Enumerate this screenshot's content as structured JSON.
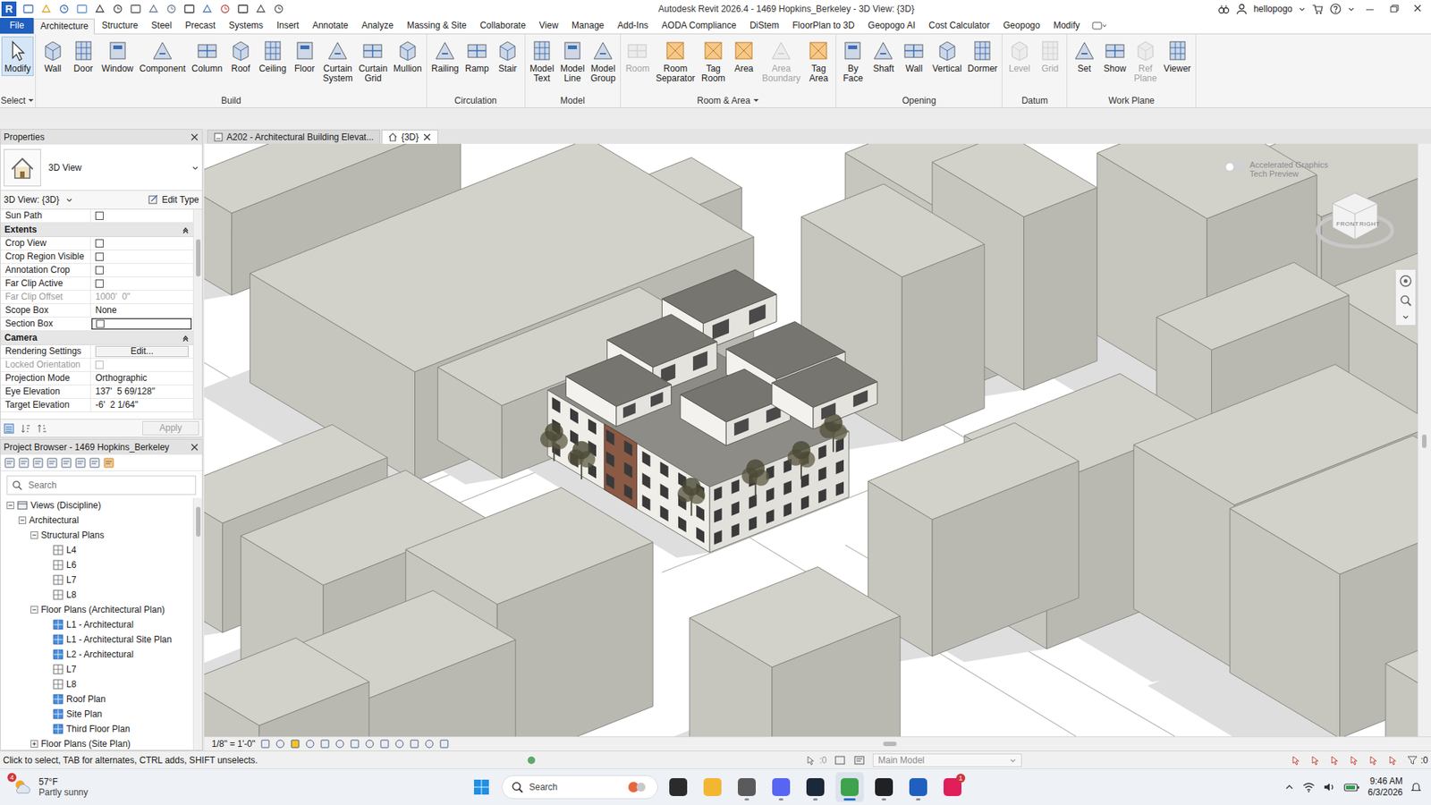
{
  "window": {
    "title": "Autodesk Revit 2026.4 - 1469 Hopkins_Berkeley - 3D View: {3D}",
    "app_letter": "R",
    "user": "hellopogo"
  },
  "ribbon_tabs": [
    {
      "label": "File",
      "selected": false,
      "kind": "file"
    },
    {
      "label": "Architecture",
      "selected": true,
      "kind": "tab"
    },
    {
      "label": "Structure",
      "selected": false,
      "kind": "tab"
    },
    {
      "label": "Steel",
      "selected": false,
      "kind": "tab"
    },
    {
      "label": "Precast",
      "selected": false,
      "kind": "tab"
    },
    {
      "label": "Systems",
      "selected": false,
      "kind": "tab"
    },
    {
      "label": "Insert",
      "selected": false,
      "kind": "tab"
    },
    {
      "label": "Annotate",
      "selected": false,
      "kind": "tab"
    },
    {
      "label": "Analyze",
      "selected": false,
      "kind": "tab"
    },
    {
      "label": "Massing & Site",
      "selected": false,
      "kind": "tab"
    },
    {
      "label": "Collaborate",
      "selected": false,
      "kind": "tab"
    },
    {
      "label": "View",
      "selected": false,
      "kind": "tab"
    },
    {
      "label": "Manage",
      "selected": false,
      "kind": "tab"
    },
    {
      "label": "Add-Ins",
      "selected": false,
      "kind": "tab"
    },
    {
      "label": "AODA Compliance",
      "selected": false,
      "kind": "tab"
    },
    {
      "label": "DiStem",
      "selected": false,
      "kind": "tab"
    },
    {
      "label": "FloorPlan to 3D",
      "selected": false,
      "kind": "tab"
    },
    {
      "label": "Geopogo AI",
      "selected": false,
      "kind": "tab"
    },
    {
      "label": "Cost Calculator",
      "selected": false,
      "kind": "tab"
    },
    {
      "label": "Geopogo",
      "selected": false,
      "kind": "tab"
    },
    {
      "label": "Modify",
      "selected": false,
      "kind": "tab"
    }
  ],
  "ribbon_groups": [
    {
      "label": "Select",
      "menu": true,
      "buttons": [
        {
          "label": "Modify",
          "selected": true,
          "disabled": false
        }
      ]
    },
    {
      "label": "Build",
      "menu": false,
      "buttons": [
        {
          "label": "Wall",
          "selected": false,
          "disabled": false
        },
        {
          "label": "Door",
          "selected": false,
          "disabled": false
        },
        {
          "label": "Window",
          "selected": false,
          "disabled": false
        },
        {
          "label": "Component",
          "selected": false,
          "disabled": false
        },
        {
          "label": "Column",
          "selected": false,
          "disabled": false
        },
        {
          "label": "Roof",
          "selected": false,
          "disabled": false
        },
        {
          "label": "Ceiling",
          "selected": false,
          "disabled": false
        },
        {
          "label": "Floor",
          "selected": false,
          "disabled": false
        },
        {
          "label": "Curtain\nSystem",
          "selected": false,
          "disabled": false
        },
        {
          "label": "Curtain\nGrid",
          "selected": false,
          "disabled": false
        },
        {
          "label": "Mullion",
          "selected": false,
          "disabled": false
        }
      ]
    },
    {
      "label": "Circulation",
      "menu": false,
      "buttons": [
        {
          "label": "Railing",
          "selected": false,
          "disabled": false
        },
        {
          "label": "Ramp",
          "selected": false,
          "disabled": false
        },
        {
          "label": "Stair",
          "selected": false,
          "disabled": false
        }
      ]
    },
    {
      "label": "Model",
      "menu": false,
      "buttons": [
        {
          "label": "Model\nText",
          "selected": false,
          "disabled": false
        },
        {
          "label": "Model\nLine",
          "selected": false,
          "disabled": false
        },
        {
          "label": "Model\nGroup",
          "selected": false,
          "disabled": false
        }
      ]
    },
    {
      "label": "Room & Area",
      "menu": true,
      "buttons": [
        {
          "label": "Room",
          "selected": false,
          "disabled": true
        },
        {
          "label": "Room\nSeparator",
          "selected": false,
          "disabled": false
        },
        {
          "label": "Tag\nRoom",
          "selected": false,
          "disabled": false
        },
        {
          "label": "Area",
          "selected": false,
          "disabled": false
        },
        {
          "label": "Area\nBoundary",
          "selected": false,
          "disabled": true
        },
        {
          "label": "Tag\nArea",
          "selected": false,
          "disabled": false
        }
      ]
    },
    {
      "label": "Opening",
      "menu": false,
      "buttons": [
        {
          "label": "By\nFace",
          "selected": false,
          "disabled": false
        },
        {
          "label": "Shaft",
          "selected": false,
          "disabled": false
        },
        {
          "label": "Wall",
          "selected": false,
          "disabled": false
        },
        {
          "label": "Vertical",
          "selected": false,
          "disabled": false
        },
        {
          "label": "Dormer",
          "selected": false,
          "disabled": false
        }
      ]
    },
    {
      "label": "Datum",
      "menu": false,
      "buttons": [
        {
          "label": "Level",
          "selected": false,
          "disabled": true
        },
        {
          "label": "Grid",
          "selected": false,
          "disabled": true
        }
      ]
    },
    {
      "label": "Work Plane",
      "menu": false,
      "buttons": [
        {
          "label": "Set",
          "selected": false,
          "disabled": false
        },
        {
          "label": "Show",
          "selected": false,
          "disabled": false
        },
        {
          "label": "Ref\nPlane",
          "selected": false,
          "disabled": true
        },
        {
          "label": "Viewer",
          "selected": false,
          "disabled": false
        }
      ]
    }
  ],
  "properties": {
    "title": "Properties",
    "type_name": "3D View",
    "instance": "3D View: {3D}",
    "edit_type": "Edit Type",
    "rows": [
      {
        "kind": "check",
        "label": "Sun Path",
        "checked": false,
        "disabled": false,
        "selected": false
      },
      {
        "kind": "section",
        "label": "Extents",
        "expanded": true,
        "selected": false
      },
      {
        "kind": "check",
        "label": "Crop View",
        "checked": false,
        "disabled": false,
        "selected": false
      },
      {
        "kind": "check",
        "label": "Crop Region Visible",
        "checked": false,
        "disabled": false,
        "selected": false
      },
      {
        "kind": "check",
        "label": "Annotation Crop",
        "checked": false,
        "disabled": false,
        "selected": false
      },
      {
        "kind": "check",
        "label": "Far Clip Active",
        "checked": false,
        "disabled": false,
        "selected": false
      },
      {
        "kind": "text",
        "label": "Far Clip Offset",
        "value": "1000'  0\"",
        "disabled": true,
        "selected": false
      },
      {
        "kind": "text",
        "label": "Scope Box",
        "value": "None",
        "disabled": false,
        "selected": false
      },
      {
        "kind": "check",
        "label": "Section Box",
        "checked": false,
        "disabled": false,
        "selected": true
      },
      {
        "kind": "section",
        "label": "Camera",
        "expanded": true,
        "selected": false
      },
      {
        "kind": "button",
        "label": "Rendering Settings",
        "value": "Edit...",
        "disabled": false,
        "selected": false
      },
      {
        "kind": "check",
        "label": "Locked Orientation",
        "checked": false,
        "disabled": true,
        "selected": false
      },
      {
        "kind": "text",
        "label": "Projection Mode",
        "value": "Orthographic",
        "disabled": false,
        "selected": false
      },
      {
        "kind": "text",
        "label": "Eye Elevation",
        "value": "137'  5 69/128\"",
        "disabled": false,
        "selected": false
      },
      {
        "kind": "text",
        "label": "Target Elevation",
        "value": "-6'  2 1/64\"",
        "disabled": false,
        "selected": false
      }
    ],
    "apply": {
      "label": "Apply",
      "disabled": true
    }
  },
  "project_browser": {
    "title": "Project Browser - 1469 Hopkins_Berkeley",
    "search": {
      "placeholder": "Search"
    },
    "tree": [
      {
        "label": "Views (Discipline)",
        "kind": "root",
        "expanded": true,
        "children": [
          {
            "label": "Architectural",
            "kind": "group",
            "expanded": true,
            "children": [
              {
                "label": "Structural Plans",
                "kind": "group",
                "expanded": true,
                "children": [
                  {
                    "label": "L4",
                    "kind": "view",
                    "placed": false,
                    "selected": false
                  },
                  {
                    "label": "L6",
                    "kind": "view",
                    "placed": false,
                    "selected": false
                  },
                  {
                    "label": "L7",
                    "kind": "view",
                    "placed": false,
                    "selected": false
                  },
                  {
                    "label": "L8",
                    "kind": "view",
                    "placed": false,
                    "selected": false
                  }
                ]
              },
              {
                "label": "Floor Plans (Architectural Plan)",
                "kind": "group",
                "expanded": true,
                "children": [
                  {
                    "label": "L1 - Architectural",
                    "kind": "view",
                    "placed": true,
                    "selected": false
                  },
                  {
                    "label": "L1 - Architectural Site Plan",
                    "kind": "view",
                    "placed": true,
                    "selected": false
                  },
                  {
                    "label": "L2 - Architectural",
                    "kind": "view",
                    "placed": true,
                    "selected": false
                  },
                  {
                    "label": "L7",
                    "kind": "view",
                    "placed": false,
                    "selected": false
                  },
                  {
                    "label": "L8",
                    "kind": "view",
                    "placed": false,
                    "selected": false
                  },
                  {
                    "label": "Roof Plan",
                    "kind": "view",
                    "placed": true,
                    "selected": false
                  },
                  {
                    "label": "Site Plan",
                    "kind": "view",
                    "placed": true,
                    "selected": false
                  },
                  {
                    "label": "Third Floor Plan",
                    "kind": "view",
                    "placed": true,
                    "selected": false
                  }
                ]
              },
              {
                "label": "Floor Plans (Site Plan)",
                "kind": "group",
                "expanded": false,
                "children": []
              }
            ]
          }
        ]
      }
    ]
  },
  "view_tabs": [
    {
      "label": "A202 - Architectural Building Elevat...",
      "selected": false
    },
    {
      "label": "{3D}",
      "selected": true
    }
  ],
  "viewport": {
    "accelerated_graphics": {
      "label": "Accelerated Graphics\nTech Preview",
      "on": false
    },
    "view_cube": {
      "front": "FRONT",
      "right": "RIGHT"
    },
    "scale": "1/8\" = 1'-0\""
  },
  "status_bar": {
    "message": "Click to select, TAB for alternates, CTRL adds, SHIFT unselects.",
    "selection_count": ":0",
    "model": "Main Model",
    "filter_count": ":0"
  },
  "taskbar": {
    "weather": {
      "temp": "57°F",
      "desc": "Partly sunny",
      "badge": "4"
    },
    "search": "Search",
    "apps": [
      {
        "color": "#2b2b2b",
        "running": false,
        "focused": false,
        "badge": ""
      },
      {
        "color": "#f2b632",
        "running": false,
        "focused": false,
        "badge": ""
      },
      {
        "color": "#5a5a5a",
        "running": true,
        "focused": false,
        "badge": ""
      },
      {
        "color": "#5865f2",
        "running": true,
        "focused": false,
        "badge": ""
      },
      {
        "color": "#1b2838",
        "running": true,
        "focused": false,
        "badge": ""
      },
      {
        "color": "#3fa34d",
        "running": true,
        "focused": true,
        "badge": ""
      },
      {
        "color": "#202124",
        "running": true,
        "focused": false,
        "badge": ""
      },
      {
        "color": "#1f5fbf",
        "running": true,
        "focused": false,
        "badge": ""
      },
      {
        "color": "#e01e5a",
        "running": false,
        "focused": false,
        "badge": "1"
      }
    ],
    "time": "9:46 AM",
    "date": "6/3/2026"
  }
}
